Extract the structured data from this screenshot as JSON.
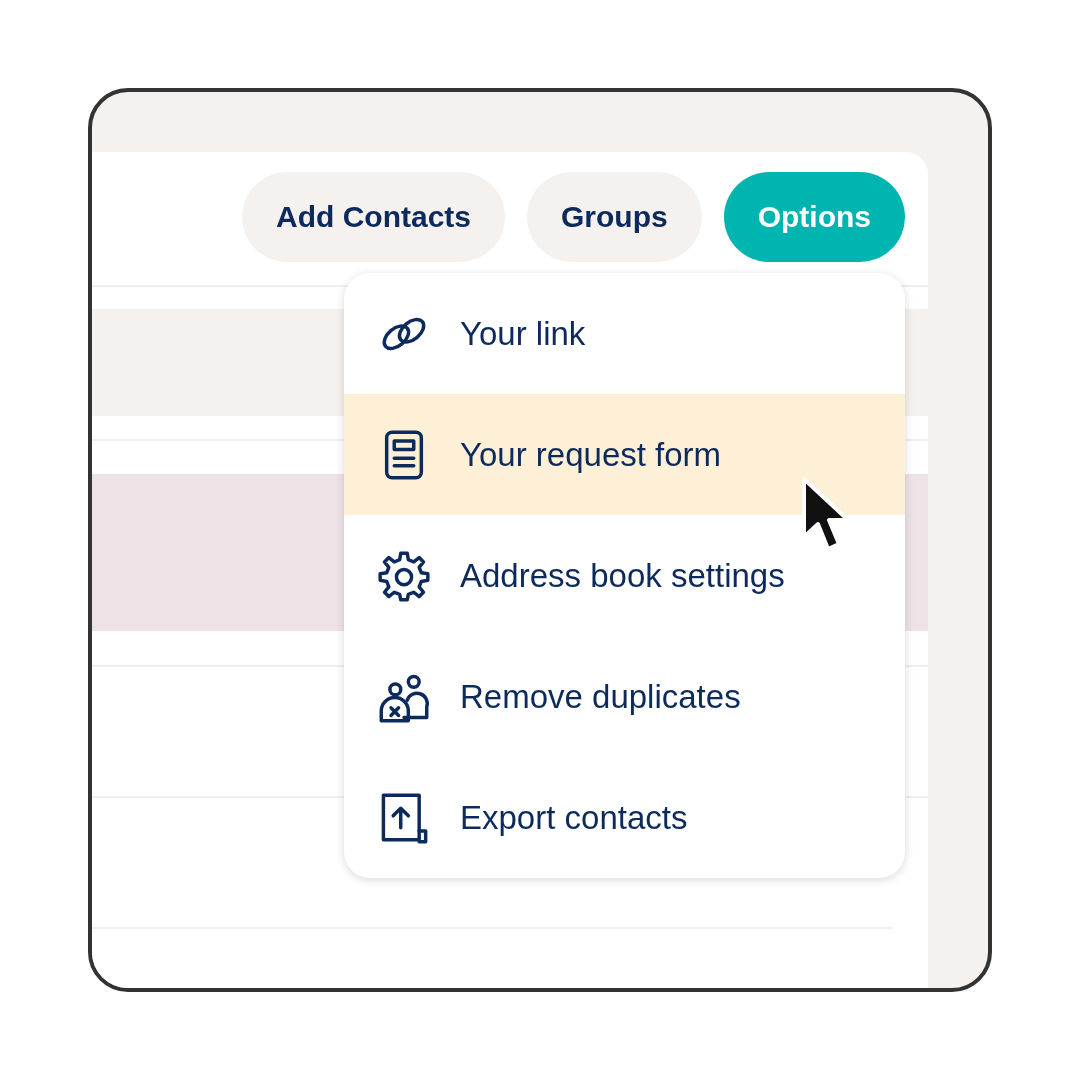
{
  "toolbar": {
    "buttons": [
      {
        "label": "Add Contacts",
        "selected": false
      },
      {
        "label": "Groups",
        "selected": false
      },
      {
        "label": "Options",
        "selected": true
      }
    ]
  },
  "options_menu": {
    "items": [
      {
        "label": "Your link",
        "selected": false
      },
      {
        "label": "Your request form",
        "selected": true
      },
      {
        "label": "Address book settings",
        "selected": false
      },
      {
        "label": "Remove duplicates",
        "selected": false
      },
      {
        "label": "Export contacts",
        "selected": false
      }
    ]
  }
}
